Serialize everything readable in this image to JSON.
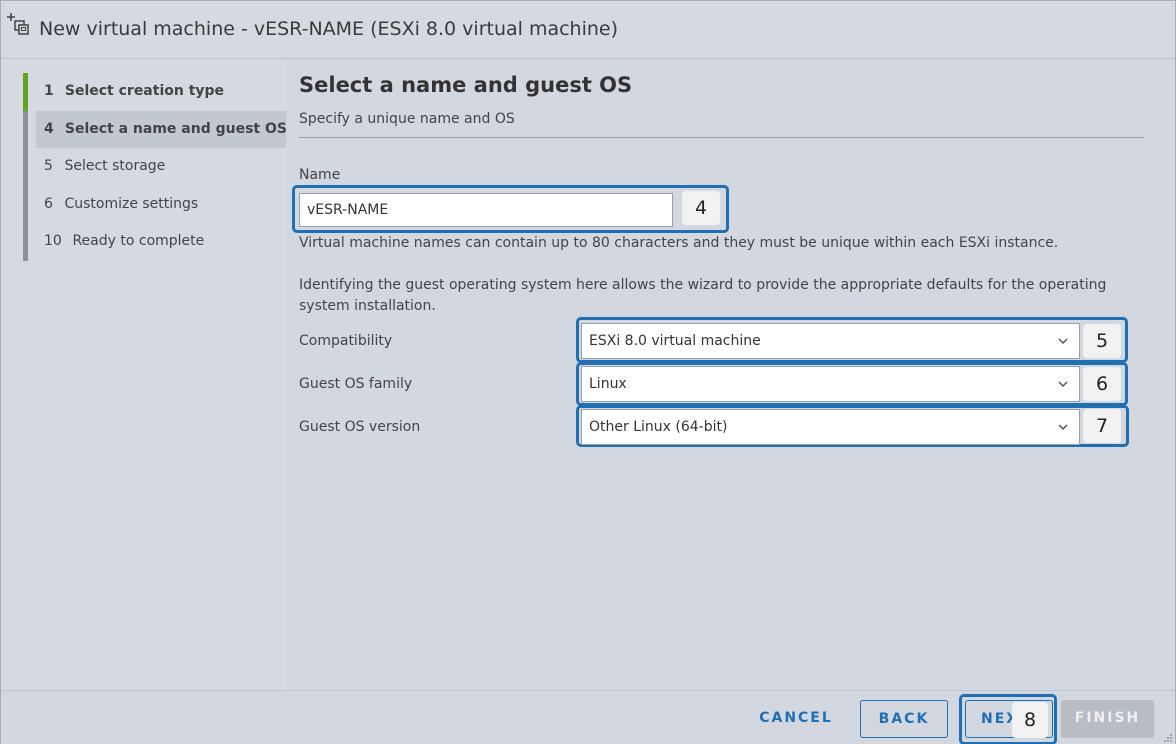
{
  "window": {
    "title": "New virtual machine - vESR-NAME (ESXi 8.0 virtual machine)"
  },
  "sidebar": {
    "steps": [
      {
        "num": "1",
        "label": "Select creation type",
        "state": "done"
      },
      {
        "num": "4",
        "label": "Select a name and guest OS",
        "state": "active"
      },
      {
        "num": "5",
        "label": "Select storage",
        "state": "pending"
      },
      {
        "num": "6",
        "label": "Customize settings",
        "state": "pending"
      },
      {
        "num": "10",
        "label": "Ready to complete",
        "state": "pending"
      }
    ]
  },
  "main": {
    "title": "Select a name and guest OS",
    "subtitle": "Specify a unique name and OS",
    "name_label": "Name",
    "name_value": "vESR-NAME",
    "name_help": "Virtual machine names can contain up to 80 characters and they must be unique within each ESXi instance.",
    "guest_info": "Identifying the guest operating system here allows the wizard to provide the appropriate defaults for the operating system installation.",
    "compatibility_label": "Compatibility",
    "compatibility_value": "ESXi 8.0 virtual machine",
    "os_family_label": "Guest OS family",
    "os_family_value": "Linux",
    "os_version_label": "Guest OS version",
    "os_version_value": "Other Linux (64-bit)"
  },
  "callouts": {
    "name": "4",
    "compatibility": "5",
    "os_family": "6",
    "os_version": "7",
    "next": "8"
  },
  "footer": {
    "cancel_label": "CANCEL",
    "back_label": "BACK",
    "next_label": "NEXT",
    "finish_label": "FINISH"
  },
  "colors": {
    "accent": "#1f6fb5",
    "step_done": "#62a420",
    "step_pending": "#8d9097",
    "finish_disabled": "#b8bcc4"
  },
  "icons": {
    "title": "add-vm-icon",
    "select_chevron": "chevron-down-icon",
    "resize": "resize-grip-icon"
  }
}
